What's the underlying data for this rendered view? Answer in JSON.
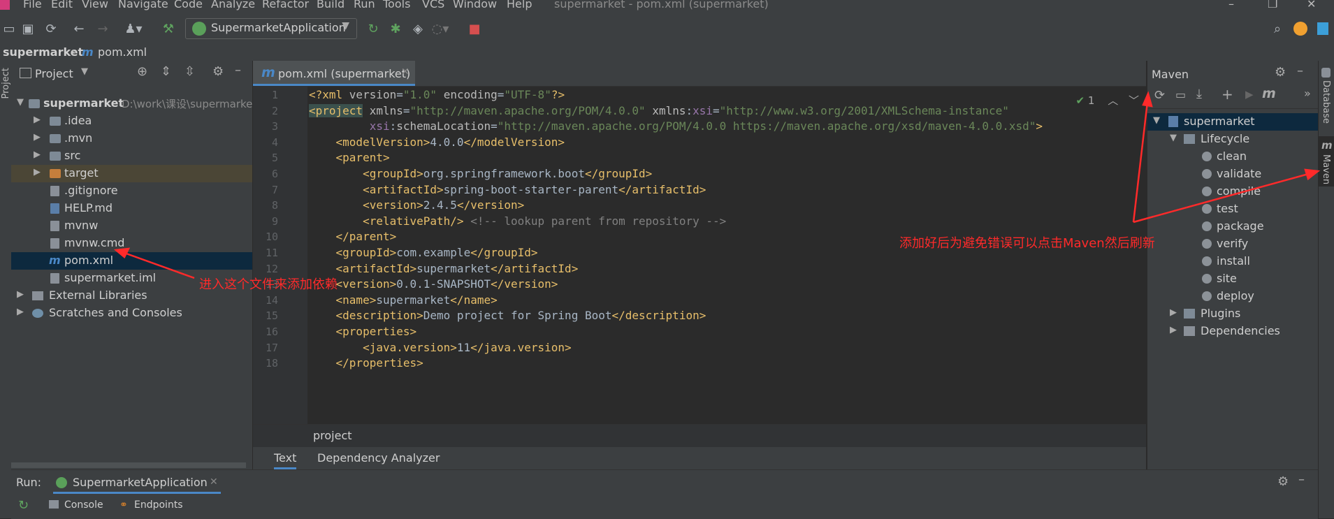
{
  "window": {
    "title": "supermarket - pom.xml (supermarket)"
  },
  "menu": [
    "File",
    "Edit",
    "View",
    "Navigate",
    "Code",
    "Analyze",
    "Refactor",
    "Build",
    "Run",
    "Tools",
    "VCS",
    "Window",
    "Help"
  ],
  "toolbar": {
    "run_config": "SupermarketApplication"
  },
  "breadcrumb": {
    "project": "supermarket",
    "file": "pom.xml"
  },
  "left_strip": {
    "project_tab": "Project"
  },
  "project_panel": {
    "title": "Project",
    "tree": [
      {
        "label": "supermarket",
        "suffix": "D:\\work\\课设\\supermarket"
      },
      {
        "label": ".idea"
      },
      {
        "label": ".mvn"
      },
      {
        "label": "src"
      },
      {
        "label": "target"
      },
      {
        "label": ".gitignore"
      },
      {
        "label": "HELP.md"
      },
      {
        "label": "mvnw"
      },
      {
        "label": "mvnw.cmd"
      },
      {
        "label": "pom.xml"
      },
      {
        "label": "supermarket.iml"
      },
      {
        "label": "External Libraries"
      },
      {
        "label": "Scratches and Consoles"
      }
    ]
  },
  "editor": {
    "tab_label": "pom.xml (supermarket)",
    "inspection_count": "1",
    "line_numbers": [
      "1",
      "2",
      "3",
      "4",
      "5",
      "6",
      "7",
      "8",
      "9",
      "10",
      "11",
      "12",
      "13",
      "14",
      "15",
      "16",
      "17",
      "18"
    ],
    "breadcrumb": "project"
  },
  "editor_bottom_tabs": [
    "Text",
    "Dependency Analyzer"
  ],
  "maven_panel": {
    "title": "Maven",
    "root": "supermarket",
    "lifecycle": "Lifecycle",
    "goals": [
      "clean",
      "validate",
      "compile",
      "test",
      "package",
      "verify",
      "install",
      "site",
      "deploy"
    ],
    "plugins": "Plugins",
    "dependencies": "Dependencies"
  },
  "right_strip": {
    "database": "Database",
    "maven": "Maven"
  },
  "run_bar": {
    "label": "Run:",
    "config": "SupermarketApplication",
    "console": "Console",
    "endpoints": "Endpoints"
  },
  "annotations": {
    "left": "进入这个文件来添加依赖",
    "right": "添加好后为避免错误可以点击Maven然后刷新"
  }
}
